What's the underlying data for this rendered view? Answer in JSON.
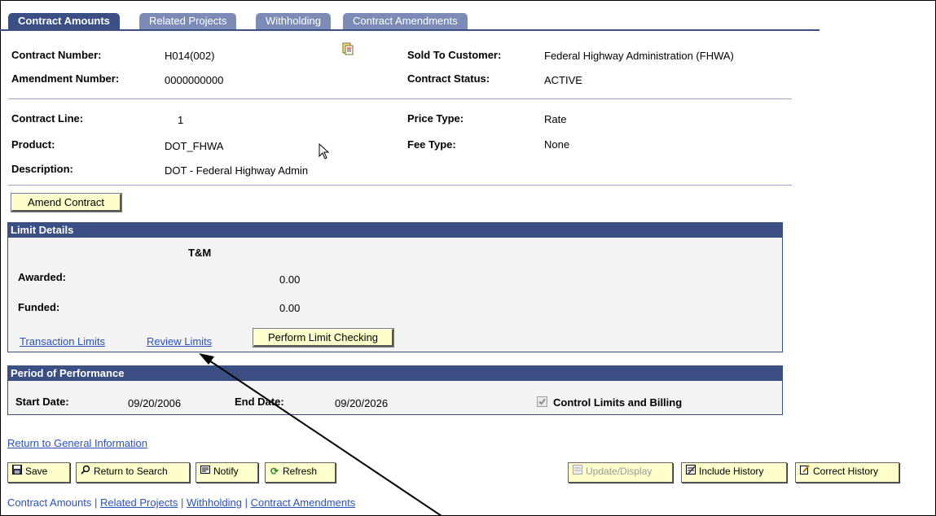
{
  "tabs": [
    {
      "label": "Contract Amounts",
      "active": true
    },
    {
      "label": "Related Projects",
      "active": false
    },
    {
      "label": "Withholding",
      "active": false
    },
    {
      "label": "Contract Amendments",
      "active": false
    }
  ],
  "header": {
    "contract_number_label": "Contract Number:",
    "contract_number": "H014(002)",
    "amendment_number_label": "Amendment Number:",
    "amendment_number": "0000000000",
    "sold_to_label": "Sold To Customer:",
    "sold_to": "Federal Highway Administration (FHWA)",
    "status_label": "Contract Status:",
    "status": "ACTIVE"
  },
  "line": {
    "contract_line_label": "Contract Line:",
    "contract_line": "1",
    "product_label": "Product:",
    "product": "DOT_FHWA",
    "description_label": "Description:",
    "description": "DOT - Federal Highway Admin",
    "price_type_label": "Price Type:",
    "price_type": "Rate",
    "fee_type_label": "Fee Type:",
    "fee_type": "None"
  },
  "amend_button": "Amend Contract",
  "limit_details": {
    "title": "Limit Details",
    "column": "T&M",
    "awarded_label": "Awarded:",
    "awarded": "0.00",
    "funded_label": "Funded:",
    "funded": "0.00",
    "transaction_limits": "Transaction Limits",
    "review_limits": "Review Limits",
    "perform_button": "Perform Limit Checking"
  },
  "period": {
    "title": "Period of Performance",
    "start_label": "Start Date:",
    "start": "09/20/2006",
    "end_label": "End Date:",
    "end": "09/20/2026",
    "control_label": "Control Limits and Billing",
    "control_checked": true
  },
  "return_link": "Return to General Information",
  "toolbar": {
    "save": "Save",
    "return_search": "Return to Search",
    "notify": "Notify",
    "refresh": "Refresh",
    "update_display": "Update/Display",
    "include_history": "Include History",
    "correct_history": "Correct History"
  },
  "bottom_nav": {
    "current": "Contract Amounts",
    "related": "Related Projects",
    "withholding": "Withholding",
    "amendments": "Contract Amendments",
    "sep": "|"
  },
  "colors": {
    "tab_active": "#3c4f84",
    "tab_inactive": "#7c8cb6",
    "button_bg": "#ffffcc",
    "link": "#2a52be"
  }
}
